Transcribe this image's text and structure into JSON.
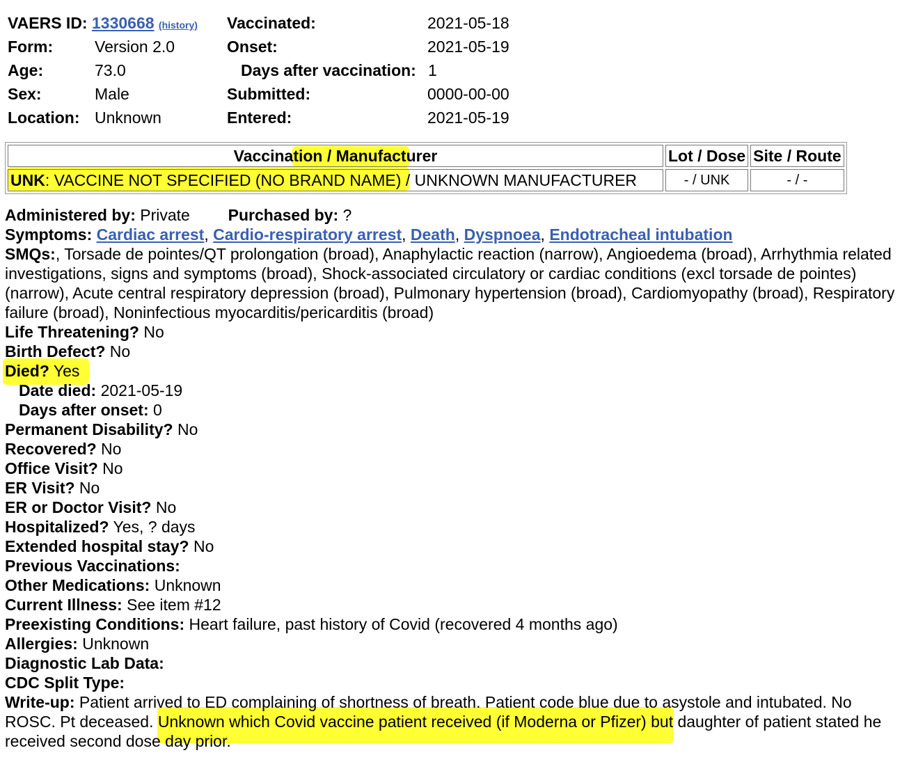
{
  "header": {
    "vaers_id_label": "VAERS ID:",
    "vaers_id": "1330668",
    "history_link": "(history)",
    "form_label": "Form:",
    "form": "Version 2.0",
    "age_label": "Age:",
    "age": "73.0",
    "sex_label": "Sex:",
    "sex": "Male",
    "location_label": "Location:",
    "location": "Unknown",
    "vaccinated_label": "Vaccinated:",
    "vaccinated": "2021-05-18",
    "onset_label": "Onset:",
    "onset": "2021-05-19",
    "days_after_label": "Days after vaccination:",
    "days_after": "1",
    "submitted_label": "Submitted:",
    "submitted": "0000-00-00",
    "entered_label": "Entered:",
    "entered": "2021-05-19"
  },
  "vaccine_table": {
    "col_vaccine": "Vaccination / Manufacturer",
    "col_lot": "Lot / Dose",
    "col_site": "Site / Route",
    "code": "UNK",
    "name": ": VACCINE NOT SPECIFIED (NO BRAND NAME) / UNKNOWN MANUFACTURER",
    "lot_dose": "- / UNK",
    "site_route": "- / -"
  },
  "details": {
    "administered_label": "Administered by:",
    "administered": " Private",
    "purchased_label": "Purchased by:",
    "purchased": " ?",
    "symptoms_label": "Symptoms:",
    "symptoms": [
      "Cardiac arrest",
      "Cardio-respiratory arrest",
      "Death",
      "Dyspnoea",
      "Endotracheal intubation"
    ],
    "smqs_label": "SMQs:",
    "smqs": ", Torsade de pointes/QT prolongation (broad), Anaphylactic reaction (narrow), Angioedema (broad), Arrhythmia related investigations, signs and symptoms (broad), Shock-associated circulatory or cardiac conditions (excl torsade de pointes) (narrow), Acute central respiratory depression (broad), Pulmonary hypertension (broad), Cardiomyopathy (broad), Respiratory failure (broad), Noninfectious myocarditis/pericarditis (broad)",
    "life_label": "Life Threatening?",
    "life": " No",
    "birth_label": "Birth Defect?",
    "birth": " No",
    "died_label": "Died?",
    "died": " Yes",
    "date_died_label": "Date died:",
    "date_died": " 2021-05-19",
    "days_onset_label": "Days after onset:",
    "days_onset": " 0",
    "disability_label": "Permanent Disability?",
    "disability": " No",
    "recovered_label": "Recovered?",
    "recovered": " No",
    "office_label": "Office Visit?",
    "office": " No",
    "er_label": "ER Visit?",
    "er": " No",
    "erdoc_label": "ER or Doctor Visit?",
    "erdoc": " No",
    "hosp_label": "Hospitalized?",
    "hosp": " Yes, ? days",
    "ext_label": "Extended hospital stay?",
    "ext": " No",
    "prev_label": "Previous Vaccinations:",
    "other_label": "Other Medications:",
    "other": " Unknown",
    "current_label": "Current Illness:",
    "current": " See item #12",
    "preexisting_label": "Preexisting Conditions:",
    "preexisting": " Heart failure, past history of Covid (recovered 4 months ago)",
    "allergies_label": "Allergies:",
    "allergies": " Unknown",
    "lab_label": "Diagnostic Lab Data:",
    "cdc_label": "CDC Split Type:",
    "writeup_label": "Write-up:",
    "writeup_a": " Patient arrived to ED complaining of shortness of breath. Patient code blue due to asystole and intubated. No ROSC. Pt deceased. ",
    "writeup_b": "Unknown which Covid vaccine patient received (if Moderna or Pfizer)",
    "writeup_c": " but daughter of patient stated he received second dose day prior."
  },
  "colors": {
    "highlight": "#ffff33",
    "link": "#3a5fb2"
  }
}
